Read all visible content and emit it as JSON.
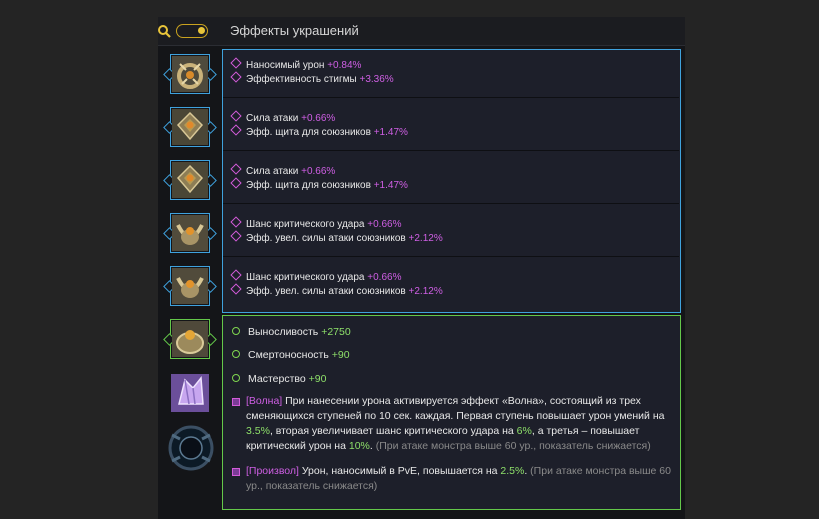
{
  "header": {
    "title": "Эффекты украшений",
    "search_icon": "search-icon",
    "toggle_state": "on"
  },
  "colors": {
    "blue_frame": "#3fa2dd",
    "green_frame": "#64c84a",
    "purple_value": "#cf5fe4",
    "green_value": "#8ee06a",
    "gold": "#e8c43a"
  },
  "sidebar": {
    "slots": [
      {
        "icon": "ring-icon",
        "frame": "blue"
      },
      {
        "icon": "earring-icon",
        "frame": "blue"
      },
      {
        "icon": "earring-icon",
        "frame": "blue"
      },
      {
        "icon": "necklace-icon",
        "frame": "blue"
      },
      {
        "icon": "necklace-icon",
        "frame": "blue"
      },
      {
        "icon": "belt-icon",
        "frame": "green"
      },
      {
        "icon": "crystal-icon",
        "frame": "none"
      },
      {
        "icon": "orb-icon",
        "frame": "none"
      }
    ]
  },
  "items": [
    {
      "stats": [
        {
          "label": "Наносимый урон",
          "value": "+0.84%"
        },
        {
          "label": "Эффективность стигмы",
          "value": "+3.36%"
        }
      ]
    },
    {
      "stats": [
        {
          "label": "Сила атаки",
          "value": "+0.66%"
        },
        {
          "label": "Эфф. щита для союзников",
          "value": "+1.47%"
        }
      ]
    },
    {
      "stats": [
        {
          "label": "Сила атаки",
          "value": "+0.66%"
        },
        {
          "label": "Эфф. щита для союзников",
          "value": "+1.47%"
        }
      ]
    },
    {
      "stats": [
        {
          "label": "Шанс критического удара",
          "value": "+0.66%"
        },
        {
          "label": "Эфф. увел. силы атаки союзников",
          "value": "+2.12%"
        }
      ]
    },
    {
      "stats": [
        {
          "label": "Шанс критического удара",
          "value": "+0.66%"
        },
        {
          "label": "Эфф. увел. силы атаки союзников",
          "value": "+2.12%"
        }
      ]
    }
  ],
  "set_bonus": {
    "stats": [
      {
        "label": "Выносливость",
        "value": "+2750"
      },
      {
        "label": "Смертоносность",
        "value": "+90"
      },
      {
        "label": "Мастерство",
        "value": "+90"
      }
    ],
    "effects": [
      {
        "tag": "[Волна]",
        "t1": " При нанесении урона активируется эффект «Волна», состоящий из трех сменяющихся ступеней по 10 сек. каждая. Первая ступень повышает урон умений на ",
        "h1": "3.5%",
        "t2": ", вторая увеличивает шанс критического удара на ",
        "h2": "6%",
        "t3": ", а третья – повышает критический урон на ",
        "h3": "10%",
        "t4": ".",
        "note": " (При атаке монстра выше 60 ур., показатель снижается)"
      },
      {
        "tag": "[Произвол]",
        "t1": " Урон, наносимый в PvE, повышается на ",
        "h1": "2.5%",
        "t2": ".",
        "note": " (При атаке монстра выше 60 ур., показатель снижается)"
      }
    ]
  }
}
